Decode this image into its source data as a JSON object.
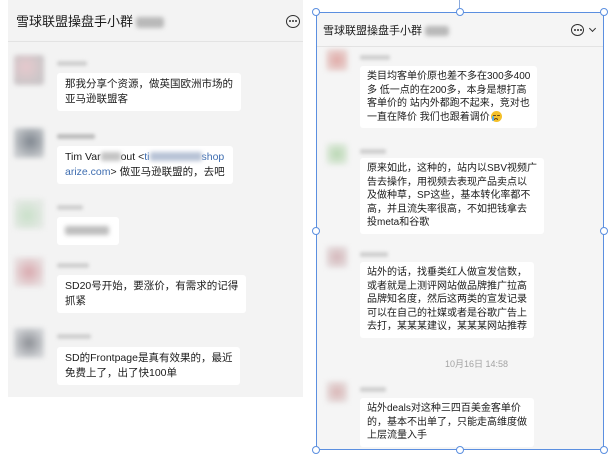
{
  "theme": {
    "page_bg": "#ffffff",
    "panel_bg": "#f3f3f3",
    "panel_bg_right": "#f5f5f5",
    "bubble_bg": "#ffffff",
    "text": "#1b1b1b",
    "link": "#3e6db0",
    "muted": "#a3a3a3",
    "selection": "#5b8fe0"
  },
  "left_chat": {
    "title": "雪球联盟操盘手小群",
    "header_icon": "chat-more-icon",
    "messages": [
      {
        "lines": [
          "那我分享个资源，做英国欧洲市场的",
          "亚马逊联盟客"
        ]
      },
      {
        "line1": {
          "text_a": "Tim Var",
          "text_b": "out <",
          "link_a": "ti",
          "link_b": "shop"
        },
        "line2": {
          "link": "arize.com",
          "text": "> 做亚马逊联盟的，去吧"
        }
      },
      {
        "lines": [
          "SD20号开始，要涨价，有需求的记得",
          "抓紧"
        ]
      },
      {
        "lines": [
          "SD的Frontpage是真有效果的，最近",
          "免费上了，出了快100单"
        ]
      }
    ]
  },
  "right_chat": {
    "title": "雪球联盟操盘手小群",
    "header_icons": [
      "chat-more-icon",
      "chevron-down-icon"
    ],
    "messages": [
      {
        "lines": [
          "类目均客单价原也差不多在300多400",
          "多 低一点的在200多，本身是想打高",
          "客单价的 站内外都跑不起来，竞对也",
          "一直在降价 我们也跟着调价"
        ],
        "emoji": "crying-face-emoji-icon"
      },
      {
        "lines": [
          "原来如此，这种的，站内以SBV视频广",
          "告去操作，用视频去表现产品卖点以",
          "及做种草，SP这些，基本转化率都不",
          "高，并且流失率很高，不如把钱拿去",
          "投meta和谷歌"
        ]
      },
      {
        "lines": [
          "站外的话，找垂类红人做宣发信数，",
          "或者就是上测评网站做品牌推广拉高",
          "品牌知名度，然后这两类的宣发记录",
          "可以在自己的社媒或者是谷歌广告上",
          "去打，某某某建议，某某某网站推荐"
        ]
      },
      {
        "lines": [
          "站外deals对这种三四百美金客单价",
          "的，基本不出单了，只能走高维度做",
          "上层流量入手"
        ]
      }
    ],
    "timestamp": "10月16日 14:58"
  }
}
